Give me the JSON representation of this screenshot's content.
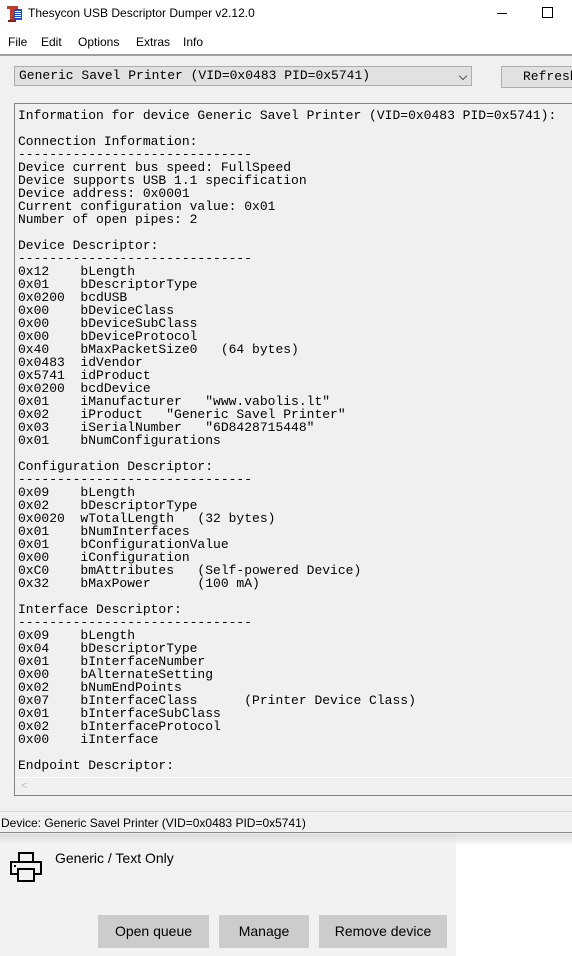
{
  "window": {
    "title": "Thesycon USB Descriptor Dumper v2.12.0",
    "icon": "app-icon",
    "controls": [
      "minimize-icon",
      "maximize-icon"
    ]
  },
  "menu": {
    "items": [
      {
        "label": "File"
      },
      {
        "label": "Edit"
      },
      {
        "label": "Options"
      },
      {
        "label": "Extras"
      },
      {
        "label": "Info"
      }
    ]
  },
  "toolbar": {
    "device_select_value": "Generic Savel Printer (VID=0x0483 PID=0x5741)",
    "refresh_label": "Refresh"
  },
  "output": {
    "lines": [
      "Information for device Generic Savel Printer (VID=0x0483 PID=0x5741):",
      "",
      "Connection Information:",
      "------------------------------",
      "Device current bus speed: FullSpeed",
      "Device supports USB 1.1 specification",
      "Device address: 0x0001",
      "Current configuration value: 0x01",
      "Number of open pipes: 2",
      "",
      "Device Descriptor:",
      "------------------------------",
      "0x12    bLength",
      "0x01    bDescriptorType",
      "0x0200  bcdUSB",
      "0x00    bDeviceClass",
      "0x00    bDeviceSubClass",
      "0x00    bDeviceProtocol",
      "0x40    bMaxPacketSize0   (64 bytes)",
      "0x0483  idVendor",
      "0x5741  idProduct",
      "0x0200  bcdDevice",
      "0x01    iManufacturer   \"www.vabolis.lt\"",
      "0x02    iProduct   \"Generic Savel Printer\"",
      "0x03    iSerialNumber   \"6D8428715448\"",
      "0x01    bNumConfigurations",
      "",
      "Configuration Descriptor:",
      "------------------------------",
      "0x09    bLength",
      "0x02    bDescriptorType",
      "0x0020  wTotalLength   (32 bytes)",
      "0x01    bNumInterfaces",
      "0x01    bConfigurationValue",
      "0x00    iConfiguration",
      "0xC0    bmAttributes   (Self-powered Device)",
      "0x32    bMaxPower      (100 mA)",
      "",
      "Interface Descriptor:",
      "------------------------------",
      "0x09    bLength",
      "0x04    bDescriptorType",
      "0x01    bInterfaceNumber",
      "0x00    bAlternateSetting",
      "0x02    bNumEndPoints",
      "0x07    bInterfaceClass      (Printer Device Class)",
      "0x01    bInterfaceSubClass",
      "0x02    bInterfaceProtocol",
      "0x00    iInterface",
      "",
      "Endpoint Descriptor:"
    ],
    "hscroll_left_glyph": "<"
  },
  "status": {
    "text": "Device: Generic Savel Printer (VID=0x0483 PID=0x5741)"
  },
  "printer_panel": {
    "icon": "printer-icon",
    "name": "Generic / Text Only",
    "buttons": {
      "open_queue": "Open queue",
      "manage": "Manage",
      "remove_device": "Remove device"
    }
  }
}
